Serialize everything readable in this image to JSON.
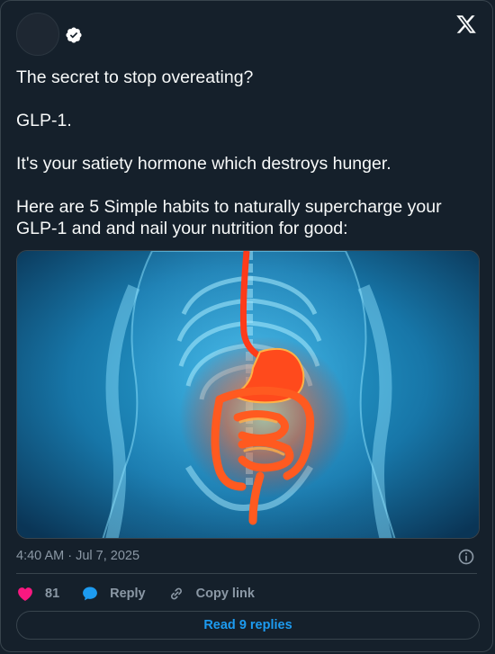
{
  "post": {
    "paragraphs": [
      "The secret to stop overeating?",
      "GLP-1.",
      "It's your satiety hormone which destroys hunger.",
      "Here are 5 Simple habits to naturally supercharge your GLP-1 and and nail your nutrition for good:"
    ],
    "timestamp": "4:40 AM · Jul 7, 2025"
  },
  "actions": {
    "likes": "81",
    "reply_label": "Reply",
    "copy_label": "Copy link"
  },
  "read_replies": "Read 9 replies",
  "icons": [
    "verified-badge-icon",
    "x-logo-icon",
    "info-icon",
    "heart-icon",
    "reply-bubble-icon",
    "link-icon"
  ],
  "colors": {
    "background": "#15202b",
    "accent": "#1d9bf0",
    "like": "#f91880",
    "muted": "#8b98a5"
  }
}
